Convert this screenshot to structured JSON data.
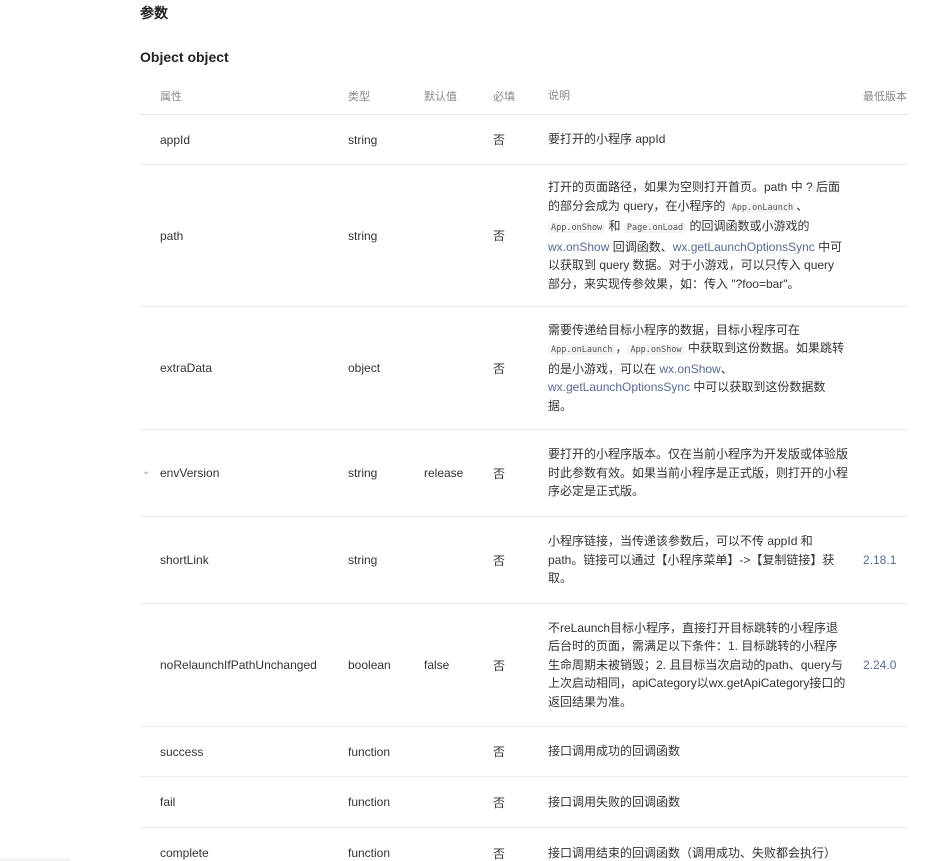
{
  "section_title": "参数",
  "object_title": "Object object",
  "headers": {
    "name": "属性",
    "type": "类型",
    "default": "默认值",
    "required": "必填",
    "desc": "说明",
    "version": "最低版本"
  },
  "rows": [
    {
      "name": "appId",
      "type": "string",
      "default": "",
      "required": "否",
      "version": "",
      "desc": [
        {
          "t": "text",
          "v": "要打开的小程序 appId"
        }
      ]
    },
    {
      "name": "path",
      "type": "string",
      "default": "",
      "required": "否",
      "version": "",
      "desc": [
        {
          "t": "text",
          "v": "打开的页面路径，如果为空则打开首页。path 中 ? 后面的部分会成为 query，在小程序的 "
        },
        {
          "t": "code",
          "v": "App.onLaunch"
        },
        {
          "t": "text",
          "v": "、"
        },
        {
          "t": "code",
          "v": "App.onShow"
        },
        {
          "t": "text",
          "v": " 和 "
        },
        {
          "t": "code",
          "v": "Page.onLoad"
        },
        {
          "t": "text",
          "v": " 的回调函数或小游戏的 "
        },
        {
          "t": "link",
          "v": "wx.onShow"
        },
        {
          "t": "text",
          "v": " 回调函数、"
        },
        {
          "t": "link",
          "v": "wx.getLaunchOptionsSync"
        },
        {
          "t": "text",
          "v": " 中可以获取到 query 数据。对于小游戏，可以只传入 query 部分，来实现传参效果，如：传入 \"?foo=bar\"。"
        }
      ]
    },
    {
      "name": "extraData",
      "type": "object",
      "default": "",
      "required": "否",
      "version": "",
      "desc": [
        {
          "t": "text",
          "v": "需要传递给目标小程序的数据，目标小程序可在 "
        },
        {
          "t": "code",
          "v": "App.onLaunch"
        },
        {
          "t": "text",
          "v": "，"
        },
        {
          "t": "code",
          "v": "App.onShow"
        },
        {
          "t": "text",
          "v": " 中获取到这份数据。如果跳转的是小游戏，可以在 "
        },
        {
          "t": "link",
          "v": "wx.onShow"
        },
        {
          "t": "text",
          "v": "、"
        },
        {
          "t": "link",
          "v": "wx.getLaunchOptionsSync"
        },
        {
          "t": "text",
          "v": " 中可以获取到这份数据数据。"
        }
      ]
    },
    {
      "name": "envVersion",
      "type": "string",
      "default": "release",
      "required": "否",
      "version": "",
      "expandable": true,
      "desc": [
        {
          "t": "text",
          "v": "要打开的小程序版本。仅在当前小程序为开发版或体验版时此参数有效。如果当前小程序是正式版，则打开的小程序必定是正式版。"
        }
      ]
    },
    {
      "name": "shortLink",
      "type": "string",
      "default": "",
      "required": "否",
      "version": "2.18.1",
      "desc": [
        {
          "t": "text",
          "v": "小程序链接，当传递该参数后，可以不传 appId 和 path。链接可以通过【小程序菜单】->【复制链接】获取。"
        }
      ]
    },
    {
      "name": "noRelaunchIfPathUnchanged",
      "type": "boolean",
      "default": "false",
      "required": "否",
      "version": "2.24.0",
      "desc": [
        {
          "t": "text",
          "v": "不reLaunch目标小程序，直接打开目标跳转的小程序退后台时的页面，需满足以下条件：1. 目标跳转的小程序生命周期未被销毁；2. 且目标当次启动的path、query与上次启动相同，apiCategory以wx.getApiCategory接口的返回结果为准。"
        }
      ]
    },
    {
      "name": "success",
      "type": "function",
      "default": "",
      "required": "否",
      "version": "",
      "desc": [
        {
          "t": "text",
          "v": "接口调用成功的回调函数"
        }
      ]
    },
    {
      "name": "fail",
      "type": "function",
      "default": "",
      "required": "否",
      "version": "",
      "desc": [
        {
          "t": "text",
          "v": "接口调用失败的回调函数"
        }
      ]
    },
    {
      "name": "complete",
      "type": "function",
      "default": "",
      "required": "否",
      "version": "",
      "desc": [
        {
          "t": "text",
          "v": "接口调用结束的回调函数（调用成功、失败都会执行）"
        }
      ]
    }
  ]
}
